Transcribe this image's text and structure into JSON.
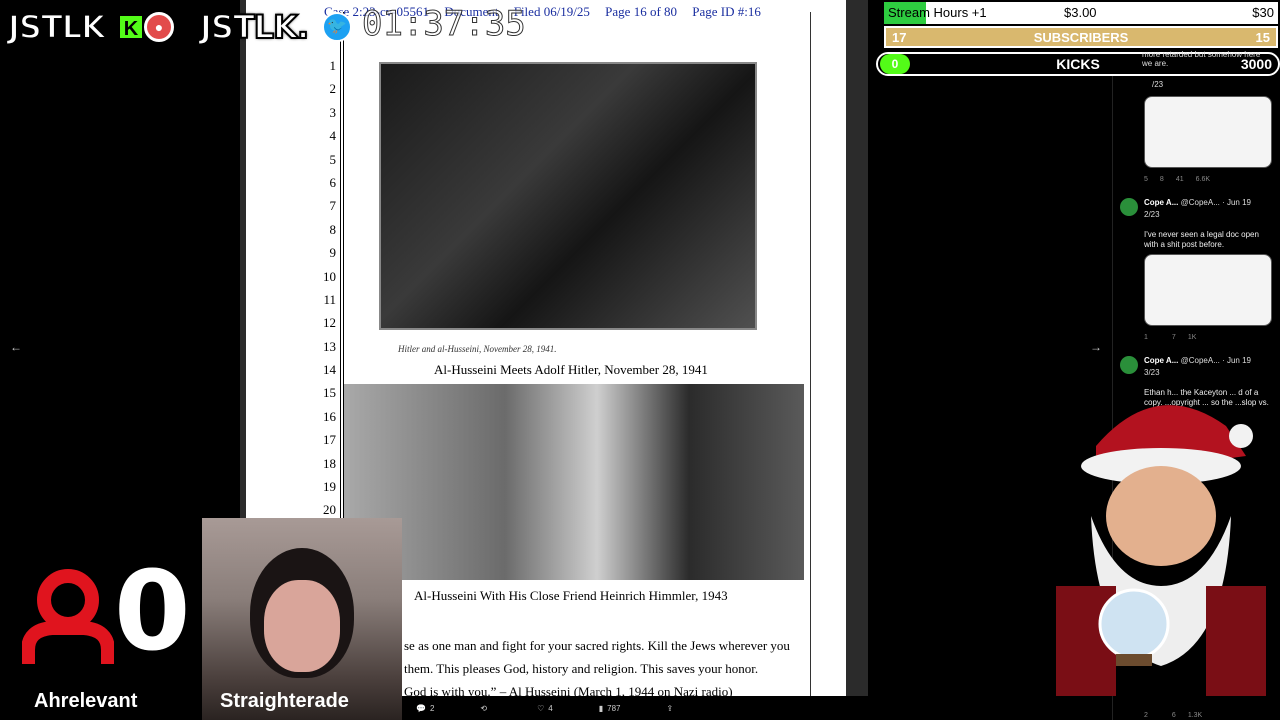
{
  "doc": {
    "header": {
      "case": "Case 2:23-cv-05561",
      "document": "Document",
      "filed": "Filed 06/19/25",
      "page": "Page 16 of 80",
      "page_id": "Page ID #:16"
    },
    "line_numbers": [
      "1",
      "2",
      "3",
      "4",
      "5",
      "6",
      "7",
      "8",
      "9",
      "10",
      "11",
      "12",
      "13",
      "14",
      "15",
      "16",
      "17",
      "18",
      "19",
      "20"
    ],
    "photo1_small_caption": "Hitler and al-Husseini, November 28, 1941.",
    "caption1": "Al-Husseini Meets Adolf Hitler, November 28, 1941",
    "caption2": "Al-Husseini With His Close Friend Heinrich Himmler, 1943",
    "quote_lines": [
      "se as one man and fight for your sacred rights. Kill the Jews wherever you",
      "them. This pleases God, history and religion. This saves your honor.",
      "God is with you.” – Al Husseini (March 1, 1944 on Nazi radio)"
    ],
    "toolbar": {
      "replies": "2",
      "retweets": "",
      "likes": "4",
      "views": "787"
    }
  },
  "overlay": {
    "logo_text": "JSTLK",
    "logo_text2": "JSTLK.",
    "kick_letter": "K",
    "timer": "01:37:35",
    "follower_count": "0",
    "name1": "Ahrelevant",
    "name2": "Straighterade"
  },
  "stats": {
    "stream_hours_label": "Stream Hours +1",
    "stream_hours_mid": "$3.00",
    "stream_hours_right": "$30",
    "subs_left": "17",
    "subs_label": "SUBSCRIBERS",
    "subs_right": "15",
    "kicks_left": "0",
    "kicks_label": "KICKS",
    "kicks_right": "3000"
  },
  "thread": {
    "frag_text": "more retarded but somehow here we are.",
    "frag_count": "/23",
    "actions1": [
      "5",
      "8",
      "41",
      "6.6K"
    ],
    "tweet2_name": "Cope A...",
    "tweet2_handle": "@CopeA... · Jun 19",
    "tweet2_count": "2/23",
    "tweet2_body": "I've never seen a legal doc open with a shit post before.",
    "actions2": [
      "1",
      "",
      "7",
      "1K"
    ],
    "tweet3_name": "Cope A...",
    "tweet3_handle": "@CopeA... · Jun 19",
    "tweet3_count": "3/23",
    "tweet3_body": "Ethan h... the Kaceyton ... d of a copy. ...opyright ... so the ...slop vs. ...o debate",
    "actions4": [
      "2",
      "",
      "6",
      "1.3K"
    ]
  },
  "colors": {
    "kick_green": "#53fc18",
    "subs_gold": "#d9b86e",
    "doc_header_blue": "#1a2ea0",
    "person_red": "#e0141e"
  }
}
